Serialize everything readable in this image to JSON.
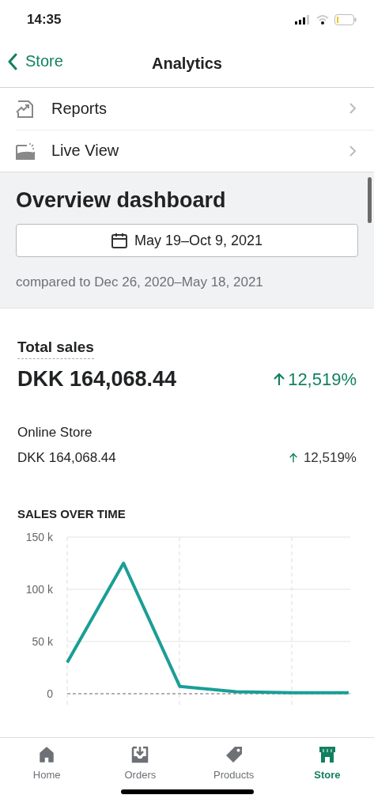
{
  "status_bar": {
    "time": "14:35"
  },
  "nav": {
    "back_label": "Store",
    "title": "Analytics"
  },
  "menu": [
    {
      "kind": "reports",
      "label": "Reports"
    },
    {
      "kind": "live",
      "label": "Live View"
    }
  ],
  "overview": {
    "title": "Overview dashboard",
    "date_range": "May 19–Oct 9, 2021",
    "comparison": "compared to Dec 26, 2020–May 18, 2021"
  },
  "total_sales": {
    "label": "Total sales",
    "value": "DKK 164,068.44",
    "change": "12,519%",
    "increase": true
  },
  "channels": [
    {
      "name": "Online Store",
      "value": "DKK 164,068.44",
      "change": "12,519%",
      "increase": true
    }
  ],
  "sales_over_time": {
    "title": "SALES OVER TIME",
    "chart_data": {
      "type": "line",
      "grid": true,
      "ylim": [
        0,
        150000
      ],
      "yticks": [
        {
          "value": 0,
          "label": "0"
        },
        {
          "value": 50000,
          "label": "50 k"
        },
        {
          "value": 100000,
          "label": "100 k"
        },
        {
          "value": 150000,
          "label": "150 k"
        }
      ],
      "series": [
        {
          "color": "#1a9e96",
          "values": [
            30000,
            125000,
            7000,
            2000,
            1000,
            1000
          ]
        }
      ]
    }
  },
  "tab_bar": [
    {
      "kind": "home",
      "label": "Home",
      "selected": false
    },
    {
      "kind": "orders",
      "label": "Orders",
      "selected": false
    },
    {
      "kind": "products",
      "label": "Products",
      "selected": false
    },
    {
      "kind": "store",
      "label": "Store",
      "selected": true
    }
  ]
}
